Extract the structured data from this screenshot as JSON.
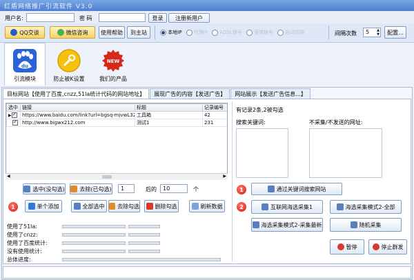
{
  "window": {
    "title": "红盾网络推广引流软件 V3.0"
  },
  "login": {
    "username_label": "用户名:",
    "username_value": "",
    "password_label": "密 码",
    "password_value": "",
    "login_button": "登录",
    "register_button": "注册新用户"
  },
  "toolbar": {
    "qq_button": "QQ交谈",
    "wechat_button": "微信咨询",
    "help_button": "使用帮助",
    "home_button": "到主站",
    "ip_options": [
      "本地IP",
      "代理IP",
      "ADSL拨号",
      "宽带拨号",
      "自动切换"
    ],
    "ip_selected": "本地IP",
    "interval_label": "间隔次数",
    "interval_value": "5",
    "config_button": "配置..."
  },
  "modules": [
    {
      "label": "引流模块",
      "icon": "baidu-paw-icon",
      "active": true
    },
    {
      "label": "防止被K设置",
      "icon": "wrench-icon",
      "active": false
    },
    {
      "label": "我们的产品",
      "icon": "new-badge-icon",
      "active": false
    }
  ],
  "tabs": [
    "目标网站【使用了百度,cnzz,51la统计代码的网站地址】",
    "展现广告的内容【发送广告】",
    "网站展示【发送广告信息...】"
  ],
  "grid": {
    "columns": [
      "选中",
      "链接",
      "标题",
      "记录编号"
    ],
    "rows": [
      {
        "selected": true,
        "link": "https://www.baidu.com/link?url=bgsq-mjvwL32q...",
        "title": "工具箱",
        "id": "42"
      },
      {
        "selected": true,
        "link": "http://www.bigwx212.com",
        "title": "测试1",
        "id": "231"
      }
    ]
  },
  "selection": {
    "select_button": "选中(没勾选)",
    "deselect_button": "去除(已勾选)",
    "from_value": "1",
    "after_label": "后的",
    "to_value": "10",
    "unit_label": "个"
  },
  "actions": {
    "step1_badge": "1",
    "add_single": "单个添加",
    "select_all": "全部选中",
    "remove_checked": "去除勾选",
    "delete_checked": "删除勾选",
    "refresh": "刷新数据"
  },
  "stats": {
    "labels": [
      "使用了51la:",
      "使用了cnzz:",
      "使用了百度统计:",
      "没有使用统计:",
      "总体进度:"
    ]
  },
  "right": {
    "summary": "有记录2条,2被勾选",
    "keywords_label": "搜索关键词:",
    "exclude_label": "不采集/不发送的网址:",
    "step1_badge": "1",
    "step2_badge": "2",
    "search_collect": "通过关键词搜索网站",
    "mass_collect1": "互联网海选采集1",
    "mass_collect_all": "海选采集模式2-全部",
    "mass_collect_latest": "海选采集模式2-采集最新",
    "random_collect": "随机采集",
    "pause": "暂停",
    "stop": "停止群发"
  }
}
